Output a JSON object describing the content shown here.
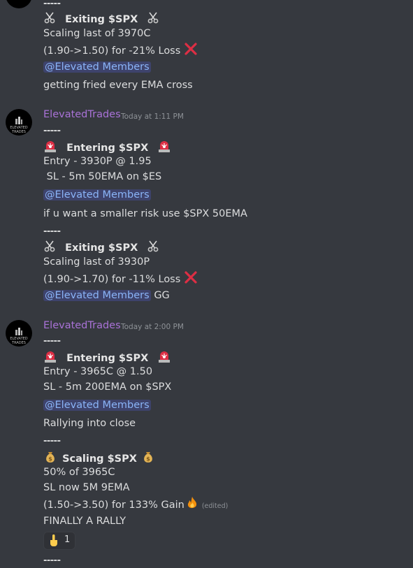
{
  "icons": {
    "scissors": "scissors-icon",
    "siren": "siren-icon",
    "cross": "cross-mark-icon",
    "money": "money-bag-icon",
    "fire": "fire-icon",
    "point": "point-up-icon"
  },
  "top": {
    "sep": "-----",
    "exit_title": "Exiting $SPX",
    "l1": "Scaling last of 3970C",
    "l2": "(1.90->1.50) for -21% Loss",
    "mention": "@Elevated Members",
    "note": "getting fried every EMA cross"
  },
  "msg1": {
    "avatar_text": "ELEVATED TRADES",
    "username": "ElevatedTrades",
    "timestamp": "Today at 1:11 PM",
    "sep": "-----",
    "enter_title": "Entering $SPX",
    "entry": "Entry - 3930P @ 1.95",
    "sl": " SL - 5m 50EMA on $ES",
    "mention": "@Elevated Members",
    "note": "if u want a smaller risk use $SPX 50EMA",
    "sep2": "-----",
    "exit_title": "Exiting $SPX",
    "scale": "Scaling last of 3930P",
    "result": "(1.90->1.70) for -11% Loss",
    "mention2": "@Elevated Members",
    "gg": "GG"
  },
  "msg2": {
    "avatar_text": "ELEVATED TRADES",
    "username": "ElevatedTrades",
    "timestamp": "Today at 2:00 PM",
    "sep": "-----",
    "enter_title": "Entering $SPX",
    "entry": "Entry - 3965C @ 1.50",
    "sl": "SL - 5m 200EMA on $SPX",
    "mention": "@Elevated Members",
    "note": "Rallying into close",
    "sep2": "-----",
    "scale_title": "Scaling $SPX",
    "half": "50% of 3965C",
    "slnow": "SL now 5M 9EMA",
    "gain": "(1.50->3.50) for 133% Gain",
    "edited": "(edited)",
    "final": "FINALLY A RALLY",
    "reaction_count": "1",
    "sep3": "-----"
  }
}
